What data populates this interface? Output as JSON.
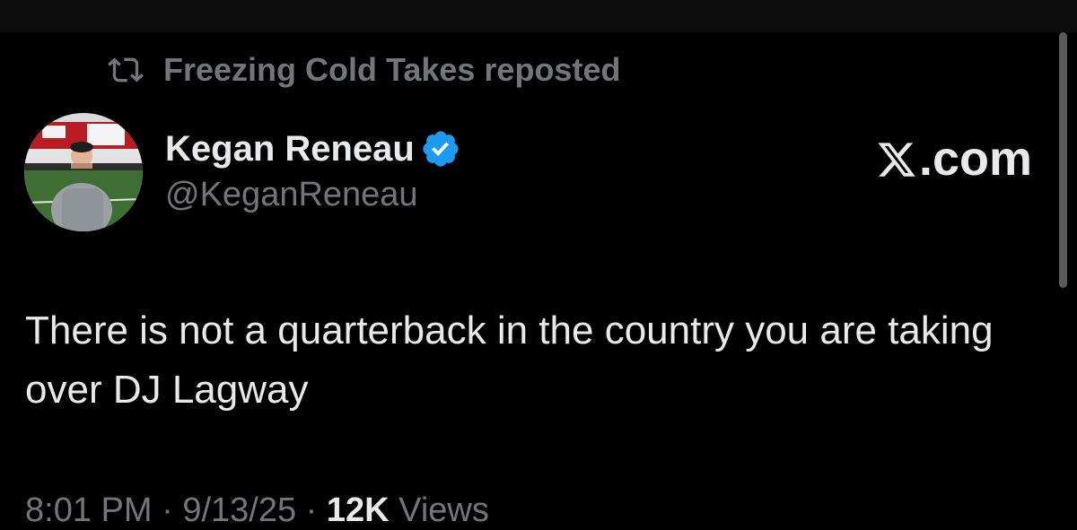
{
  "repost": {
    "label": "Freezing Cold Takes reposted",
    "icon": "repost-icon"
  },
  "author": {
    "name": "Kegan Reneau",
    "handle": "@KeganReneau",
    "verified": true,
    "verified_color": "#1d9bf0"
  },
  "brand": {
    "label": ".com"
  },
  "tweet": {
    "text": "There is not a quarterback in the country you are taking over DJ Lagway"
  },
  "meta": {
    "time": "8:01 PM",
    "separator": "·",
    "date": "9/13/25",
    "views_count": "12K",
    "views_label": "Views"
  },
  "colors": {
    "background": "#000000",
    "text_primary": "#e7e9ea",
    "text_secondary": "#71767b"
  }
}
